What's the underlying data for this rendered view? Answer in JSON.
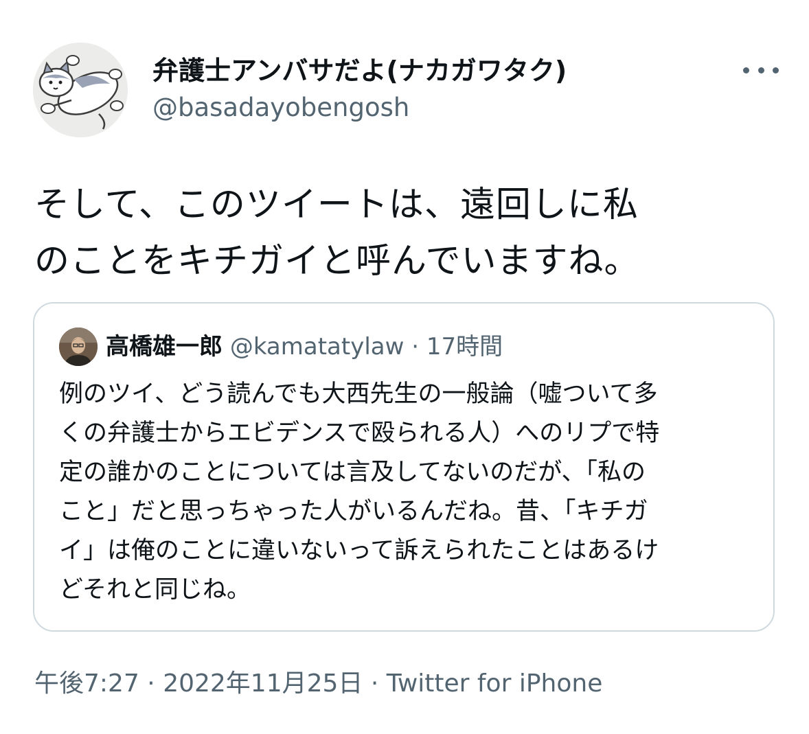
{
  "tweet": {
    "author": {
      "display_name": "弁護士アンバサだよ(ナカガワタク)",
      "handle": "@basadayobengosh",
      "avatar_icon": "cat-illustration-avatar"
    },
    "more_icon": "more-options-icon",
    "text_lines": [
      "そして、このツイートは、遠回しに私",
      "のことをキチガイと呼んでいますね。"
    ],
    "quoted": {
      "display_name": "高橋雄一郎",
      "handle": "@kamatatylaw",
      "separator": " · ",
      "time_ago": "17時間",
      "text_lines": [
        "例のツイ、どう読んでも大西先生の一般論（嘘ついて多",
        "くの弁護士からエビデンスで殴られる人）へのリプで特",
        "定の誰かのことについては言及してないのだが、「私の",
        "こと」だと思っちゃった人がいるんだね。昔、「キチガ",
        "イ」は俺のことに違いないって訴えられたことはあるけ",
        "どそれと同じね。"
      ]
    },
    "meta": {
      "time": "午後7:27",
      "sep1": " · ",
      "date": "2022年11月25日",
      "sep2": " · ",
      "source": "Twitter for iPhone"
    }
  },
  "colors": {
    "text_primary": "#0f1419",
    "text_secondary": "#536471",
    "border": "#cfd9de",
    "background": "#ffffff"
  }
}
